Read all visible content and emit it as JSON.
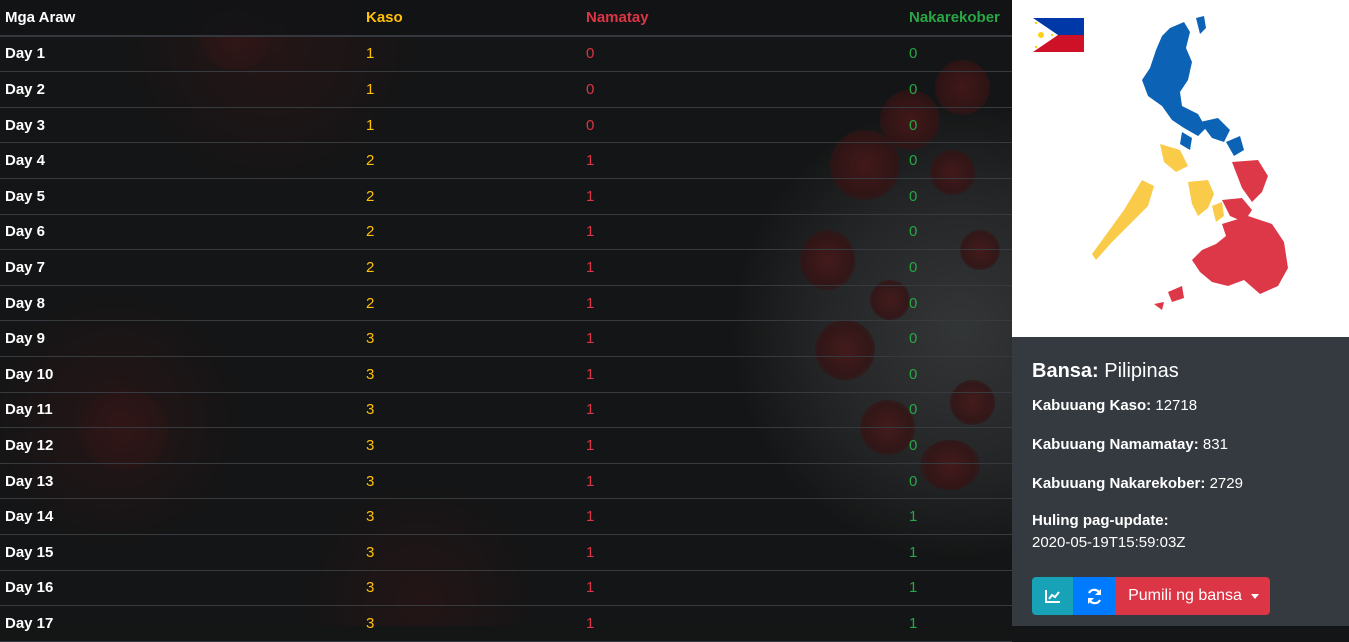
{
  "table": {
    "headers": {
      "day": "Mga Araw",
      "cases": "Kaso",
      "deaths": "Namatay",
      "recovered": "Nakarekober"
    },
    "rows": [
      {
        "day": "Day 1",
        "cases": "1",
        "deaths": "0",
        "recovered": "0"
      },
      {
        "day": "Day 2",
        "cases": "1",
        "deaths": "0",
        "recovered": "0"
      },
      {
        "day": "Day 3",
        "cases": "1",
        "deaths": "0",
        "recovered": "0"
      },
      {
        "day": "Day 4",
        "cases": "2",
        "deaths": "1",
        "recovered": "0"
      },
      {
        "day": "Day 5",
        "cases": "2",
        "deaths": "1",
        "recovered": "0"
      },
      {
        "day": "Day 6",
        "cases": "2",
        "deaths": "1",
        "recovered": "0"
      },
      {
        "day": "Day 7",
        "cases": "2",
        "deaths": "1",
        "recovered": "0"
      },
      {
        "day": "Day 8",
        "cases": "2",
        "deaths": "1",
        "recovered": "0"
      },
      {
        "day": "Day 9",
        "cases": "3",
        "deaths": "1",
        "recovered": "0"
      },
      {
        "day": "Day 10",
        "cases": "3",
        "deaths": "1",
        "recovered": "0"
      },
      {
        "day": "Day 11",
        "cases": "3",
        "deaths": "1",
        "recovered": "0"
      },
      {
        "day": "Day 12",
        "cases": "3",
        "deaths": "1",
        "recovered": "0"
      },
      {
        "day": "Day 13",
        "cases": "3",
        "deaths": "1",
        "recovered": "0"
      },
      {
        "day": "Day 14",
        "cases": "3",
        "deaths": "1",
        "recovered": "1"
      },
      {
        "day": "Day 15",
        "cases": "3",
        "deaths": "1",
        "recovered": "1"
      },
      {
        "day": "Day 16",
        "cases": "3",
        "deaths": "1",
        "recovered": "1"
      },
      {
        "day": "Day 17",
        "cases": "3",
        "deaths": "1",
        "recovered": "1"
      }
    ]
  },
  "panel": {
    "country_label": "Bansa:",
    "country_value": "Pilipinas",
    "total_cases_label": "Kabuuang Kaso:",
    "total_cases_value": "12718",
    "total_deaths_label": "Kabuuang Namamatay:",
    "total_deaths_value": "831",
    "total_recovered_label": "Kabuuang Nakarekober:",
    "total_recovered_value": "2729",
    "updated_label": "Huling pag-update:",
    "updated_value": "2020-05-19T15:59:03Z",
    "buttons": {
      "chart_icon": "chart-line-icon",
      "refresh_icon": "refresh-icon",
      "select_label": "Pumili ng bansa"
    }
  },
  "colors": {
    "cases": "#ffc107",
    "deaths": "#dc3545",
    "recovered": "#28a745",
    "panel_bg": "#343a40",
    "chart_button": "#17a2b8",
    "refresh_button": "#007bff",
    "select_button": "#dc3545"
  }
}
